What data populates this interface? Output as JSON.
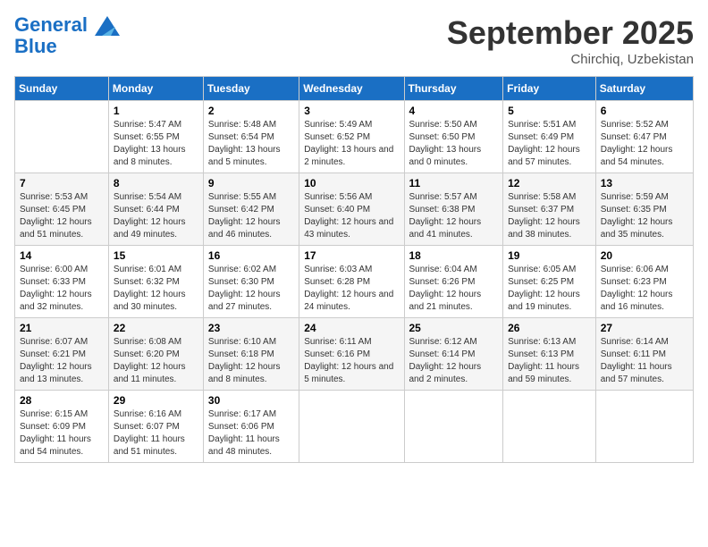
{
  "header": {
    "logo_line1": "General",
    "logo_line2": "Blue",
    "month_title": "September 2025",
    "location": "Chirchiq, Uzbekistan"
  },
  "days_of_week": [
    "Sunday",
    "Monday",
    "Tuesday",
    "Wednesday",
    "Thursday",
    "Friday",
    "Saturday"
  ],
  "weeks": [
    [
      {
        "day": "",
        "sunrise": "",
        "sunset": "",
        "daylight": ""
      },
      {
        "day": "1",
        "sunrise": "5:47 AM",
        "sunset": "6:55 PM",
        "daylight": "13 hours and 8 minutes."
      },
      {
        "day": "2",
        "sunrise": "5:48 AM",
        "sunset": "6:54 PM",
        "daylight": "13 hours and 5 minutes."
      },
      {
        "day": "3",
        "sunrise": "5:49 AM",
        "sunset": "6:52 PM",
        "daylight": "13 hours and 2 minutes."
      },
      {
        "day": "4",
        "sunrise": "5:50 AM",
        "sunset": "6:50 PM",
        "daylight": "13 hours and 0 minutes."
      },
      {
        "day": "5",
        "sunrise": "5:51 AM",
        "sunset": "6:49 PM",
        "daylight": "12 hours and 57 minutes."
      },
      {
        "day": "6",
        "sunrise": "5:52 AM",
        "sunset": "6:47 PM",
        "daylight": "12 hours and 54 minutes."
      }
    ],
    [
      {
        "day": "7",
        "sunrise": "5:53 AM",
        "sunset": "6:45 PM",
        "daylight": "12 hours and 51 minutes."
      },
      {
        "day": "8",
        "sunrise": "5:54 AM",
        "sunset": "6:44 PM",
        "daylight": "12 hours and 49 minutes."
      },
      {
        "day": "9",
        "sunrise": "5:55 AM",
        "sunset": "6:42 PM",
        "daylight": "12 hours and 46 minutes."
      },
      {
        "day": "10",
        "sunrise": "5:56 AM",
        "sunset": "6:40 PM",
        "daylight": "12 hours and 43 minutes."
      },
      {
        "day": "11",
        "sunrise": "5:57 AM",
        "sunset": "6:38 PM",
        "daylight": "12 hours and 41 minutes."
      },
      {
        "day": "12",
        "sunrise": "5:58 AM",
        "sunset": "6:37 PM",
        "daylight": "12 hours and 38 minutes."
      },
      {
        "day": "13",
        "sunrise": "5:59 AM",
        "sunset": "6:35 PM",
        "daylight": "12 hours and 35 minutes."
      }
    ],
    [
      {
        "day": "14",
        "sunrise": "6:00 AM",
        "sunset": "6:33 PM",
        "daylight": "12 hours and 32 minutes."
      },
      {
        "day": "15",
        "sunrise": "6:01 AM",
        "sunset": "6:32 PM",
        "daylight": "12 hours and 30 minutes."
      },
      {
        "day": "16",
        "sunrise": "6:02 AM",
        "sunset": "6:30 PM",
        "daylight": "12 hours and 27 minutes."
      },
      {
        "day": "17",
        "sunrise": "6:03 AM",
        "sunset": "6:28 PM",
        "daylight": "12 hours and 24 minutes."
      },
      {
        "day": "18",
        "sunrise": "6:04 AM",
        "sunset": "6:26 PM",
        "daylight": "12 hours and 21 minutes."
      },
      {
        "day": "19",
        "sunrise": "6:05 AM",
        "sunset": "6:25 PM",
        "daylight": "12 hours and 19 minutes."
      },
      {
        "day": "20",
        "sunrise": "6:06 AM",
        "sunset": "6:23 PM",
        "daylight": "12 hours and 16 minutes."
      }
    ],
    [
      {
        "day": "21",
        "sunrise": "6:07 AM",
        "sunset": "6:21 PM",
        "daylight": "12 hours and 13 minutes."
      },
      {
        "day": "22",
        "sunrise": "6:08 AM",
        "sunset": "6:20 PM",
        "daylight": "12 hours and 11 minutes."
      },
      {
        "day": "23",
        "sunrise": "6:10 AM",
        "sunset": "6:18 PM",
        "daylight": "12 hours and 8 minutes."
      },
      {
        "day": "24",
        "sunrise": "6:11 AM",
        "sunset": "6:16 PM",
        "daylight": "12 hours and 5 minutes."
      },
      {
        "day": "25",
        "sunrise": "6:12 AM",
        "sunset": "6:14 PM",
        "daylight": "12 hours and 2 minutes."
      },
      {
        "day": "26",
        "sunrise": "6:13 AM",
        "sunset": "6:13 PM",
        "daylight": "11 hours and 59 minutes."
      },
      {
        "day": "27",
        "sunrise": "6:14 AM",
        "sunset": "6:11 PM",
        "daylight": "11 hours and 57 minutes."
      }
    ],
    [
      {
        "day": "28",
        "sunrise": "6:15 AM",
        "sunset": "6:09 PM",
        "daylight": "11 hours and 54 minutes."
      },
      {
        "day": "29",
        "sunrise": "6:16 AM",
        "sunset": "6:07 PM",
        "daylight": "11 hours and 51 minutes."
      },
      {
        "day": "30",
        "sunrise": "6:17 AM",
        "sunset": "6:06 PM",
        "daylight": "11 hours and 48 minutes."
      },
      {
        "day": "",
        "sunrise": "",
        "sunset": "",
        "daylight": ""
      },
      {
        "day": "",
        "sunrise": "",
        "sunset": "",
        "daylight": ""
      },
      {
        "day": "",
        "sunrise": "",
        "sunset": "",
        "daylight": ""
      },
      {
        "day": "",
        "sunrise": "",
        "sunset": "",
        "daylight": ""
      }
    ]
  ]
}
